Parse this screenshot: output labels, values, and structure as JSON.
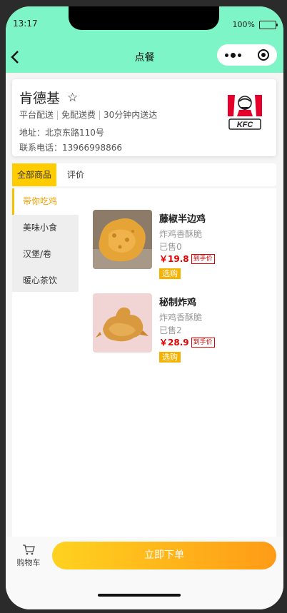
{
  "status_bar": {
    "time": "13:17",
    "battery": "100%"
  },
  "nav": {
    "title": "点餐"
  },
  "store": {
    "name": "肯德基",
    "tags": [
      "平台配送",
      "免配送费",
      "30分钟内送达"
    ],
    "address": "地址：北京东路110号",
    "phone": "联系电话：13966998866",
    "logo_text": "KFC"
  },
  "tabs": [
    {
      "label": "全部商品",
      "active": true
    },
    {
      "label": "评价",
      "active": false
    }
  ],
  "categories": [
    {
      "label": "带你吃鸡",
      "active": true
    },
    {
      "label": "美味小食",
      "active": false
    },
    {
      "label": "汉堡/卷",
      "active": false
    },
    {
      "label": "暖心茶饮",
      "active": false
    }
  ],
  "items": [
    {
      "name": "藤椒半边鸡",
      "desc": "炸鸡香酥脆",
      "sold": "已售0",
      "price": "￥19.8",
      "price_tag": "到手价",
      "spec_button": "选购"
    },
    {
      "name": "秘制炸鸡",
      "desc": "炸鸡香酥脆",
      "sold": "已售2",
      "price": "￥28.9",
      "price_tag": "到手价",
      "spec_button": "选购"
    }
  ],
  "bottom": {
    "cart_label": "购物车",
    "order_button": "立即下单"
  },
  "colors": {
    "header": "#7ef5c6",
    "accent": "#ffcc00",
    "price": "#e00000"
  }
}
